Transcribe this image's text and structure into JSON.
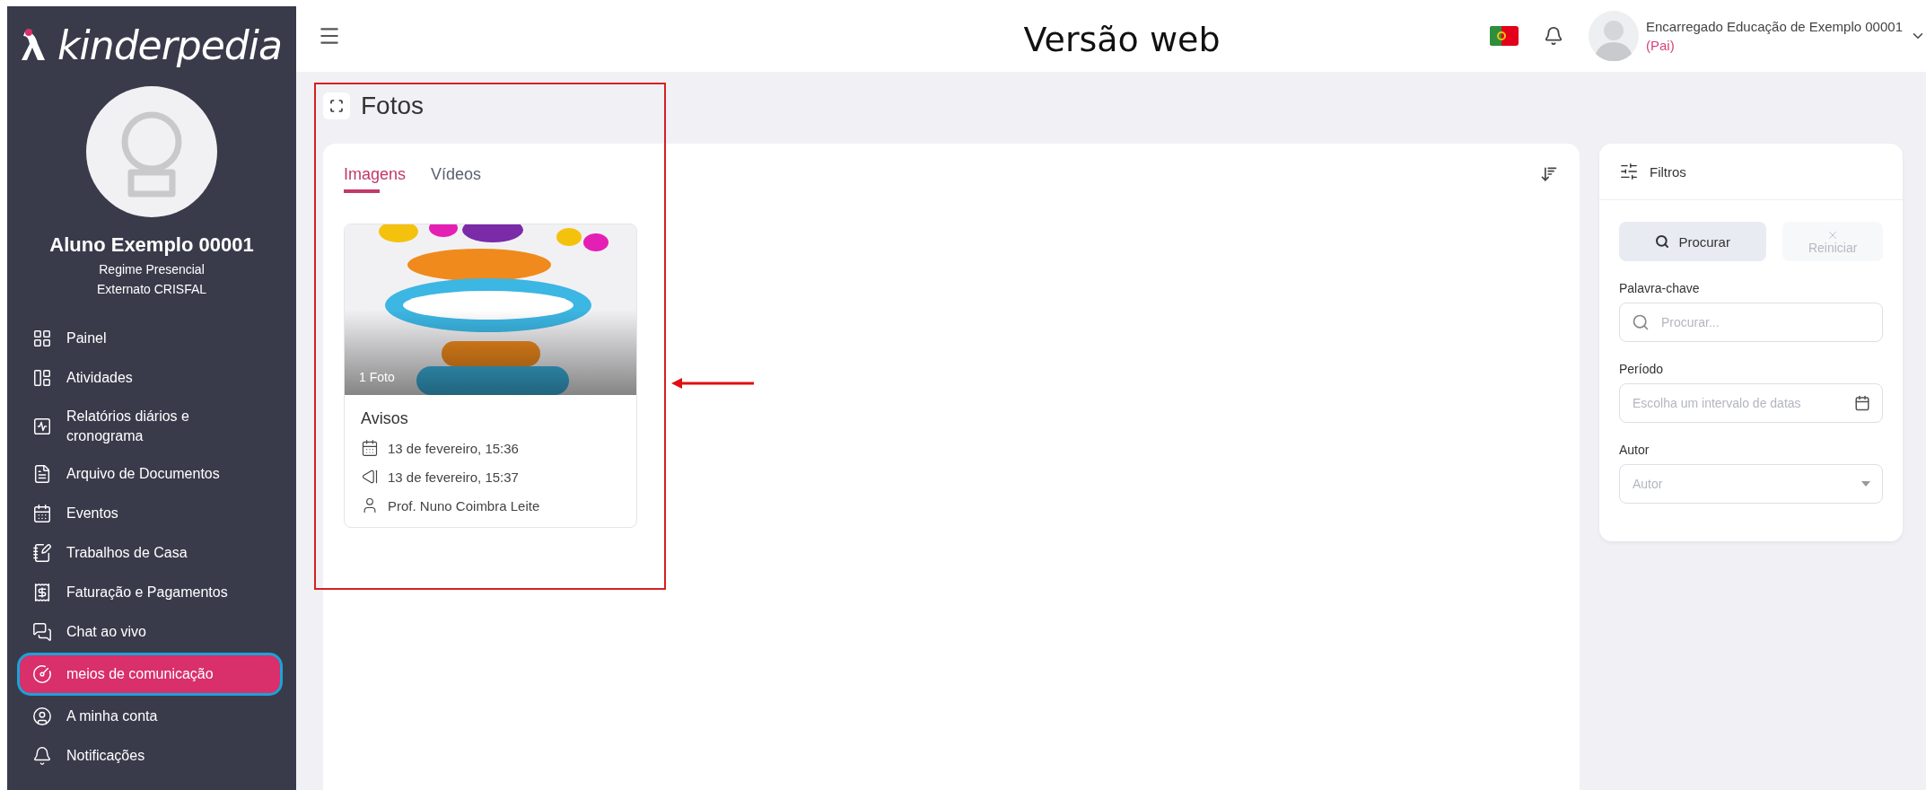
{
  "annotation": {
    "caption": "Versão web"
  },
  "sidebar": {
    "logo": "**kinder**pedia",
    "student": {
      "name": "Aluno Exemplo 00001",
      "lines": [
        "Regime Presencial",
        "Externato CRISFAL"
      ]
    },
    "items": [
      {
        "label": "Painel",
        "selected": false
      },
      {
        "label": "Atividades",
        "selected": false
      },
      {
        "label": "Relatórios diários e cronograma",
        "selected": false
      },
      {
        "label": "Arquivo de Documentos",
        "selected": false
      },
      {
        "label": "Eventos",
        "selected": false
      },
      {
        "label": "Trabalhos de Casa",
        "selected": false
      },
      {
        "label": "Faturação e Pagamentos",
        "selected": false
      },
      {
        "label": "Chat ao vivo",
        "selected": false
      },
      {
        "label": "meios de comunicação",
        "selected": true
      },
      {
        "label": "A minha conta",
        "selected": false
      },
      {
        "label": "Notificações",
        "selected": false
      }
    ]
  },
  "header": {
    "user": {
      "name": "Encarregado Educação de Exemplo 00001",
      "relation": "(Pai)"
    }
  },
  "page": {
    "title": "Fotos"
  },
  "tabs": [
    {
      "label": "Imagens",
      "selected": true
    },
    {
      "label": "Vídeos",
      "selected": false
    }
  ],
  "albums": [
    {
      "count": "1 Foto",
      "title": "Avisos",
      "created": "13 de fevereiro, 15:36",
      "published": "13 de fevereiro, 15:37",
      "author": "Prof. Nuno Coimbra Leite"
    }
  ],
  "filters": {
    "title": "Filtros",
    "search_button": "Procurar",
    "reset_button": {
      "label": "Reiniciar",
      "disabled": true
    },
    "fields": [
      {
        "kind": "search",
        "label": "Palavra-chave",
        "placeholder": "Procurar..."
      },
      {
        "kind": "date",
        "label": "Período",
        "placeholder": "Escolha um intervalo de datas"
      },
      {
        "kind": "select",
        "label": "Autor",
        "placeholder": "Autor"
      }
    ]
  }
}
